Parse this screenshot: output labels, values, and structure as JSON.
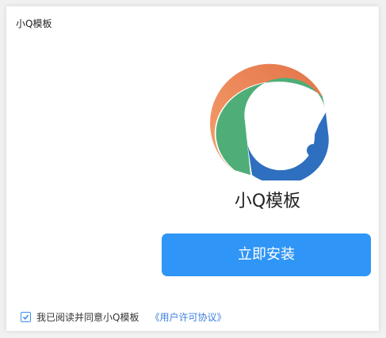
{
  "window": {
    "title": "小Q模板"
  },
  "product": {
    "name": "小Q模板"
  },
  "install_button": {
    "label": "立即安装"
  },
  "agreement": {
    "checked": true,
    "text": "我已阅读并同意小Q模板",
    "link_text": "《用户许可协议》"
  },
  "colors": {
    "accent": "#2f95f6",
    "logo_orange": "#ef8f5d",
    "logo_green": "#4fae78",
    "logo_blue": "#2f6fbf",
    "link": "#3b7fe0"
  }
}
